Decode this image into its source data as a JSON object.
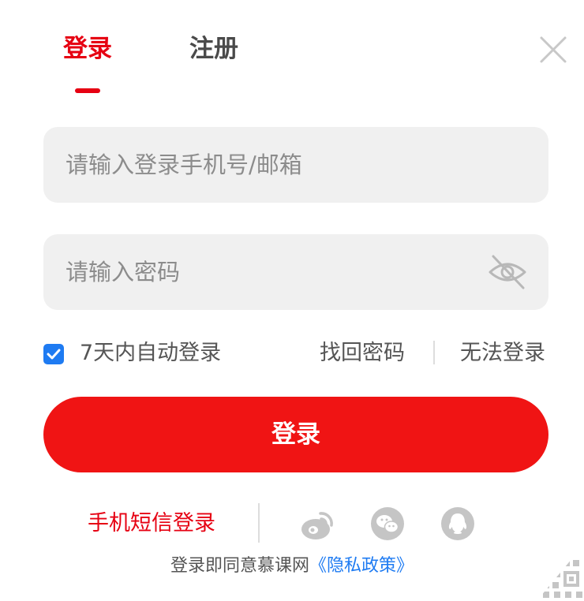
{
  "tabs": {
    "login": "登录",
    "register": "注册"
  },
  "form": {
    "account_placeholder": "请输入登录手机号/邮箱",
    "password_placeholder": "请输入密码",
    "remember_label": "7天内自动登录",
    "remember_checked": true,
    "find_password": "找回密码",
    "cannot_login": "无法登录",
    "submit": "登录"
  },
  "alt_login": {
    "sms": "手机短信登录",
    "icons": [
      "weibo-icon",
      "wechat-icon",
      "qq-icon"
    ]
  },
  "agreement": {
    "prefix": "登录即同意慕课网",
    "policy": "《隐私政策》"
  },
  "colors": {
    "brand_red": "#e60012",
    "button_red": "#f01414",
    "link_blue": "#1e7bf2",
    "field_bg": "#f0f0f0",
    "icon_gray": "#c5c5c5"
  }
}
